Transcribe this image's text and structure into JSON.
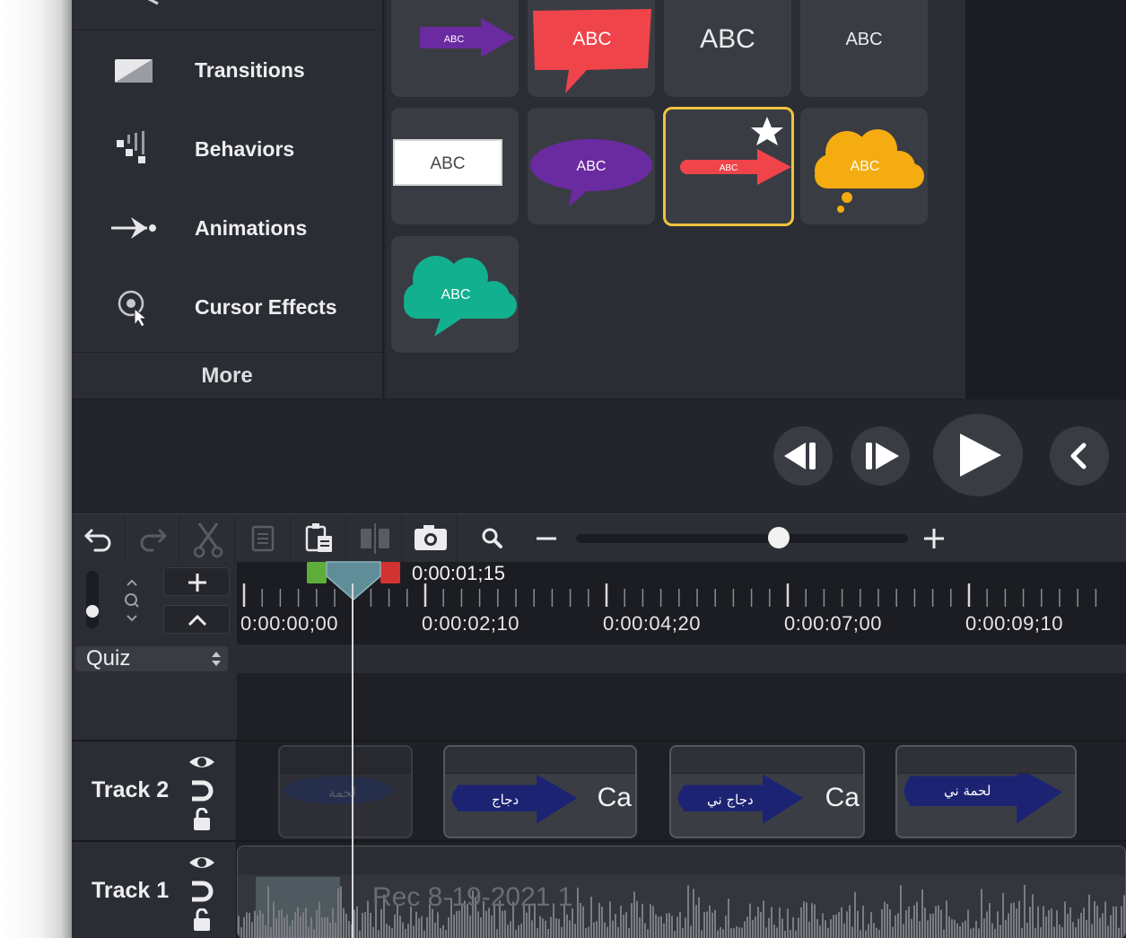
{
  "sidebar": {
    "items": [
      {
        "label": "Transitions",
        "icon": "transitions-icon"
      },
      {
        "label": "Behaviors",
        "icon": "behaviors-icon"
      },
      {
        "label": "Animations",
        "icon": "animations-icon"
      },
      {
        "label": "Cursor Effects",
        "icon": "cursor-effects-icon"
      }
    ],
    "more_label": "More"
  },
  "annotations": {
    "tiles": [
      {
        "label": "ABC",
        "style": "purple-arrow"
      },
      {
        "label": "ABC",
        "style": "red-callout"
      },
      {
        "label": "ABC",
        "style": "plain-text-large"
      },
      {
        "label": "ABC",
        "style": "plain-text-small"
      },
      {
        "label": "ABC",
        "style": "white-box"
      },
      {
        "label": "ABC",
        "style": "purple-speech"
      },
      {
        "label": "ABC",
        "style": "red-arrow",
        "selected": true,
        "favorite": true
      },
      {
        "label": "ABC",
        "style": "yellow-thought"
      },
      {
        "label": "ABC",
        "style": "teal-cloud"
      }
    ],
    "selected_color": "#f0c23c"
  },
  "playback": {
    "buttons": [
      "step-back",
      "step-forward",
      "play",
      "collapse"
    ]
  },
  "timeline": {
    "playhead_time": "0:00:01;15",
    "ruler_labels": [
      "0:00:00;00",
      "0:00:02;10",
      "0:00:04;20",
      "0:00:07;00",
      "0:00:09;10"
    ],
    "zoom_level": 0.62,
    "quiz_label": "Quiz",
    "tracks": [
      {
        "name": "Track 2",
        "clips": [
          {
            "text": "لحمة",
            "suffix": ""
          },
          {
            "text": "دجاج",
            "suffix": "Ca"
          },
          {
            "text": "دجاج ني",
            "suffix": "Ca"
          },
          {
            "text": "لحمة ني",
            "suffix": ""
          }
        ]
      },
      {
        "name": "Track 1",
        "media_title": "Rec 8-19-2021 1"
      }
    ]
  },
  "colors": {
    "arrow_navy": "#1d2373",
    "accent_yellow": "#f0c23c",
    "callout_red": "#f0444b",
    "purple": "#6a2aa0",
    "teal": "#12b08e",
    "orange": "#f5ac10"
  }
}
